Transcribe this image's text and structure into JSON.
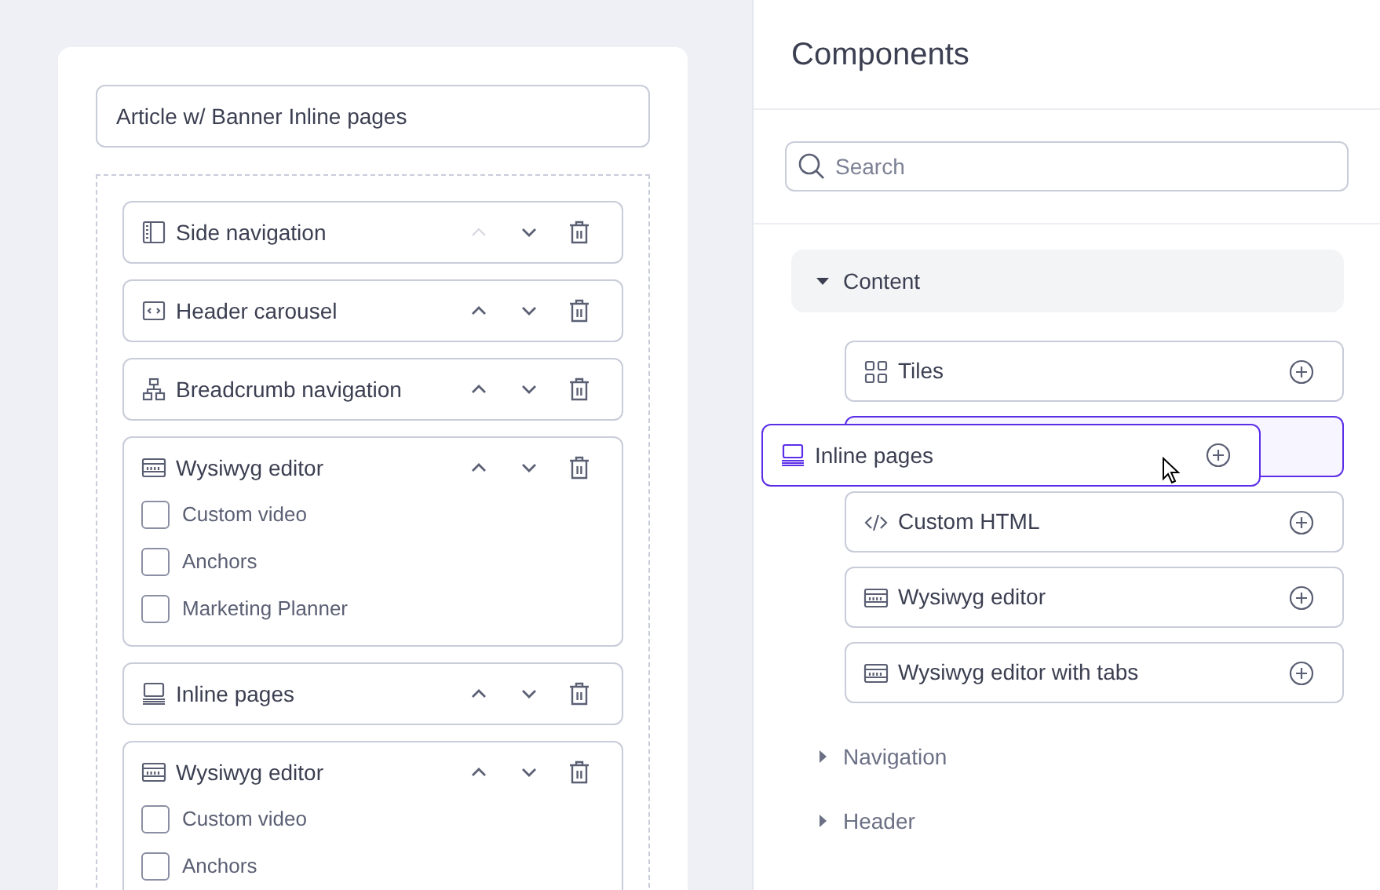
{
  "page_title": {
    "value": "Article w/ Banner Inline pages"
  },
  "blocks": [
    {
      "label": "Side navigation",
      "kind": "sidebar",
      "up_disabled": true
    },
    {
      "label": "Header carousel",
      "kind": "carousel",
      "up_disabled": false
    },
    {
      "label": "Breadcrumb navigation",
      "kind": "sitemap",
      "up_disabled": false
    },
    {
      "label": "Wysiwyg editor",
      "kind": "editor",
      "up_disabled": false,
      "options": [
        {
          "label": "Custom video",
          "checked": false
        },
        {
          "label": "Anchors",
          "checked": false
        },
        {
          "label": "Marketing Planner",
          "checked": false
        }
      ]
    },
    {
      "label": "Inline pages",
      "kind": "inline",
      "up_disabled": false
    },
    {
      "label": "Wysiwyg editor",
      "kind": "editor",
      "up_disabled": false,
      "options": [
        {
          "label": "Custom video",
          "checked": false
        },
        {
          "label": "Anchors",
          "checked": false
        }
      ]
    }
  ],
  "panel": {
    "title": "Components",
    "search": {
      "placeholder": "Search"
    },
    "categories": [
      {
        "label": "Content",
        "expanded": true,
        "items": [
          {
            "label": "Tiles",
            "kind": "tiles"
          },
          {
            "kind": "slot"
          },
          {
            "label": "Custom HTML",
            "kind": "code"
          },
          {
            "label": "Wysiwyg editor",
            "kind": "editor"
          },
          {
            "label": "Wysiwyg editor with tabs",
            "kind": "editor"
          }
        ]
      },
      {
        "label": "Navigation",
        "expanded": false
      },
      {
        "label": "Header",
        "expanded": false
      }
    ]
  },
  "drag_item": {
    "label": "Inline pages",
    "kind": "inline"
  }
}
